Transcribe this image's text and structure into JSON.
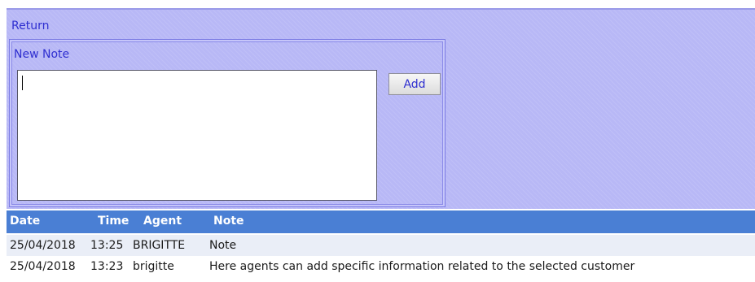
{
  "return_label": "Return",
  "new_note": {
    "legend": "New Note",
    "input_value": "",
    "add_label": "Add"
  },
  "notes_table": {
    "headers": {
      "date": "Date",
      "time": "Time",
      "agent": "Agent",
      "note": "Note"
    },
    "rows": [
      {
        "date": "25/04/2018",
        "time": "13:25",
        "agent": "BRIGITTE",
        "note": "Note"
      },
      {
        "date": "25/04/2018",
        "time": "13:23",
        "agent": "brigitte",
        "note": "Here agents can add specific information related to the selected customer"
      }
    ]
  },
  "colors": {
    "panel_bg": "#b8b8f6",
    "link_text": "#2f2fd0",
    "header_bg": "#4a7fd4",
    "row_alt_bg": "#eaeef7"
  }
}
